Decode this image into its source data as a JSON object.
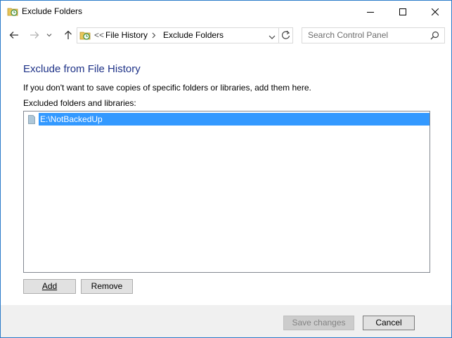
{
  "window": {
    "title": "Exclude Folders"
  },
  "navigation": {
    "breadcrumb_overflow": "<<",
    "breadcrumbs": [
      "File History",
      "Exclude Folders"
    ],
    "search_placeholder": "Search Control Panel"
  },
  "main": {
    "heading": "Exclude from File History",
    "description": "If you don't want to save copies of specific folders or libraries, add them here.",
    "list_label": "Excluded folders and libraries:",
    "excluded_items": [
      {
        "path": "E:\\NotBackedUp",
        "selected": true
      }
    ]
  },
  "buttons": {
    "add_label": "Add",
    "remove_label": "Remove",
    "save_label": "Save changes",
    "save_enabled": false,
    "cancel_label": "Cancel"
  },
  "colors": {
    "heading": "#1e3287",
    "selection": "#3399ff",
    "footer_bg": "#f0f0f0",
    "window_border": "#2b7bc9"
  },
  "icons": {
    "title": "file-history-icon",
    "back": "arrow-left-icon",
    "forward": "arrow-right-icon",
    "recent": "chevron-down-icon",
    "up": "arrow-up-icon",
    "refresh": "refresh-icon",
    "search": "search-icon",
    "folder": "folder-icon"
  }
}
